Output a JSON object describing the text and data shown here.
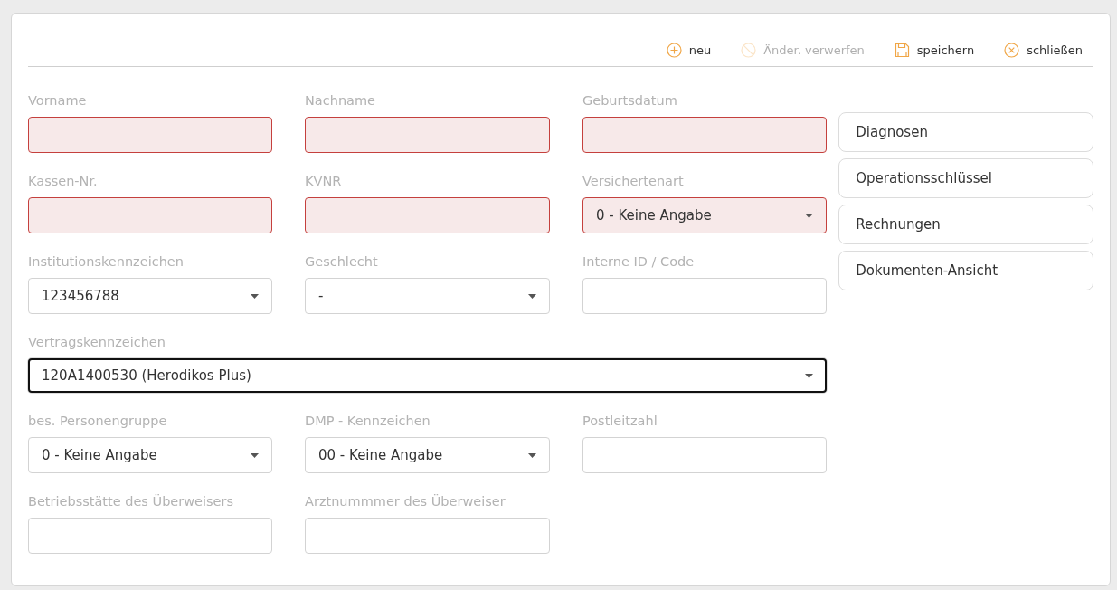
{
  "toolbar": [
    {
      "kind": "add",
      "label": "neu",
      "disabled": false
    },
    {
      "kind": "discard",
      "label": "Änder. verwerfen",
      "disabled": true
    },
    {
      "kind": "save",
      "label": "speichern",
      "disabled": false
    },
    {
      "kind": "close",
      "label": "schließen",
      "disabled": false
    }
  ],
  "fields": [
    {
      "label": "Vorname",
      "kind": "text",
      "invalid": true,
      "focused": false,
      "wide": false
    },
    {
      "label": "Nachname",
      "kind": "text",
      "invalid": true,
      "focused": false,
      "wide": false
    },
    {
      "label": "Geburtsdatum",
      "kind": "text",
      "invalid": true,
      "focused": false,
      "wide": false
    },
    {
      "label": "Kassen-Nr.",
      "kind": "text",
      "invalid": true,
      "focused": false,
      "wide": false
    },
    {
      "label": "KVNR",
      "kind": "text",
      "invalid": true,
      "focused": false,
      "wide": false
    },
    {
      "label": "Versichertenart",
      "kind": "select",
      "value": "0 - Keine Angabe",
      "invalid": true,
      "focused": false,
      "wide": false
    },
    {
      "label": "Institutionskennzeichen",
      "kind": "select",
      "value": "123456788",
      "invalid": false,
      "focused": false,
      "wide": false
    },
    {
      "label": "Geschlecht",
      "kind": "select",
      "value": "-",
      "invalid": false,
      "focused": false,
      "wide": false
    },
    {
      "label": "Interne ID / Code",
      "kind": "text",
      "invalid": false,
      "focused": false,
      "wide": false
    },
    {
      "label": "Vertragskennzeichen",
      "kind": "select",
      "value": "120A1400530 (Herodikos Plus)",
      "invalid": false,
      "focused": true,
      "wide": true
    },
    {
      "label": "bes. Personengruppe",
      "kind": "select",
      "value": "0 - Keine Angabe",
      "invalid": false,
      "focused": false,
      "wide": false
    },
    {
      "label": "DMP - Kennzeichen",
      "kind": "select",
      "value": "00 - Keine Angabe",
      "invalid": false,
      "focused": false,
      "wide": false
    },
    {
      "label": "Postleitzahl",
      "kind": "text",
      "invalid": false,
      "focused": false,
      "wide": false
    },
    {
      "label": "Betriebsstätte des Überweisers",
      "kind": "text",
      "invalid": false,
      "focused": false,
      "wide": false
    },
    {
      "label": "Arztnummmer des Überweiser",
      "kind": "text",
      "invalid": false,
      "focused": false,
      "wide": false
    }
  ],
  "side_buttons": [
    "Diagnosen",
    "Operationsschlüssel",
    "Rechnungen",
    "Dokumenten-Ansicht"
  ]
}
